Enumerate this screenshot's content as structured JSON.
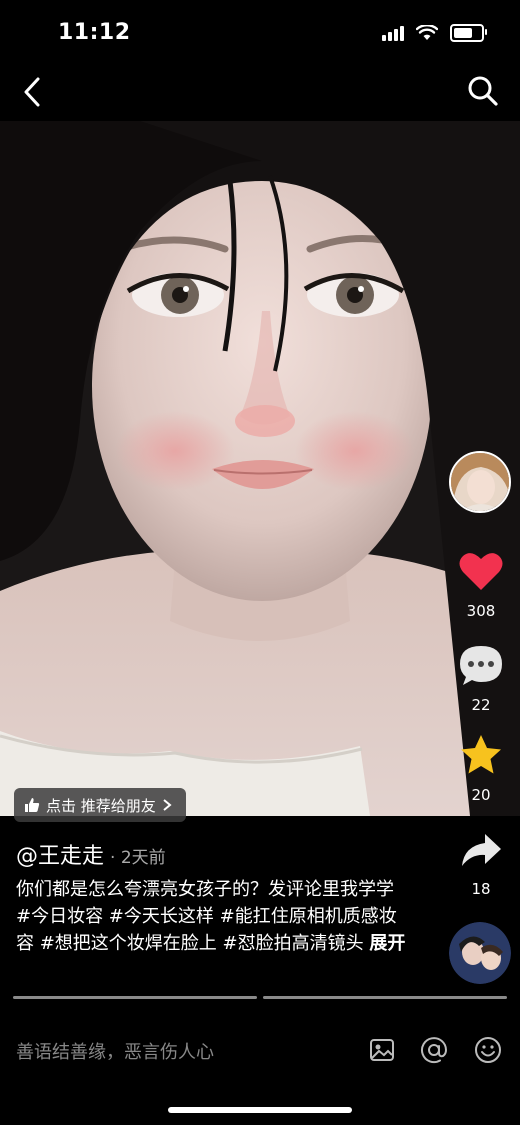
{
  "status": {
    "time": "11:12",
    "battery_level": 0.8
  },
  "nav": {
    "back_icon": "chevron-left-icon",
    "search_icon": "search-icon"
  },
  "recommend": {
    "label": "点击 推荐给朋友"
  },
  "actions": {
    "likes": "308",
    "comments": "22",
    "favorites": "20",
    "shares": "18",
    "like_color": "#f2324f",
    "favorite_color": "#f7c21e"
  },
  "post": {
    "author": "@王走走",
    "time": "· 2天前",
    "caption": "你们都是怎么夸漂亮女孩子的？发评论里我学学#今日妆容 #今天长这样 #能扛住原相机质感妆容 #想把这个妆焊在脸上 #怼脸拍高清镜头",
    "expand": "展开"
  },
  "comment": {
    "placeholder": "善语结善缘，恶言伤人心"
  }
}
